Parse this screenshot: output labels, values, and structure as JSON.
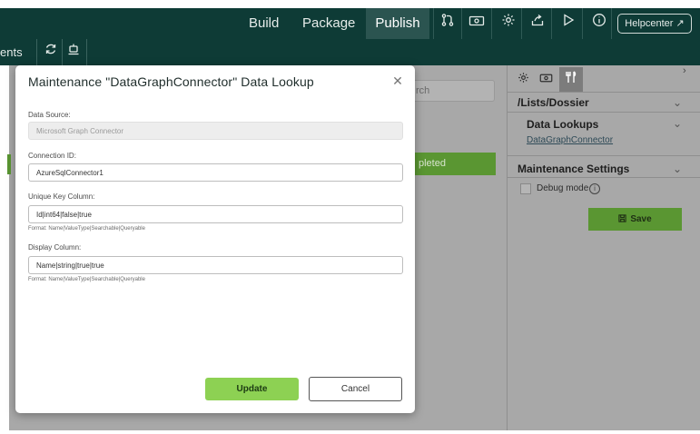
{
  "topbar": {
    "nav": [
      "Build",
      "Package",
      "Publish"
    ],
    "active": "Publish",
    "icons": [
      "git-branch-icon",
      "cash-icon",
      "gear-icon",
      "share-icon",
      "play-icon",
      "info-icon"
    ],
    "help_label": "Helpcenter ↗"
  },
  "subbar": {
    "text": "ents",
    "icons": [
      "refresh-icon",
      "robot-icon"
    ]
  },
  "background": {
    "search_placeholder": "rch",
    "status_text": "pleted"
  },
  "right_panel": {
    "path": "/Lists/Dossier",
    "data_lookups_heading": "Data Lookups",
    "data_lookup_link": "DataGraphConnector",
    "maintenance_heading": "Maintenance Settings",
    "debug_label": "Debug mode",
    "save_label": "Save"
  },
  "modal": {
    "title": "Maintenance \"DataGraphConnector\" Data Lookup",
    "data_source_label": "Data Source:",
    "data_source_value": "Microsoft Graph Connector",
    "connection_id_label": "Connection ID:",
    "connection_id_value": "AzureSqlConnector1",
    "unique_key_label": "Unique Key Column:",
    "unique_key_value": "Id|int64|false|true",
    "unique_key_hint": "Format: Name|ValueType|Searchable|Queryable",
    "display_column_label": "Display Column:",
    "display_column_value": "Name|string|true|true",
    "display_column_hint": "Format: Name|ValueType|Searchable|Queryable",
    "update_label": "Update",
    "cancel_label": "Cancel"
  },
  "colors": {
    "header_bg": "#0e3b36",
    "accent_green": "#8dd153",
    "dim_green": "#5a9632",
    "overlay_gray": "#a8a8a8"
  }
}
